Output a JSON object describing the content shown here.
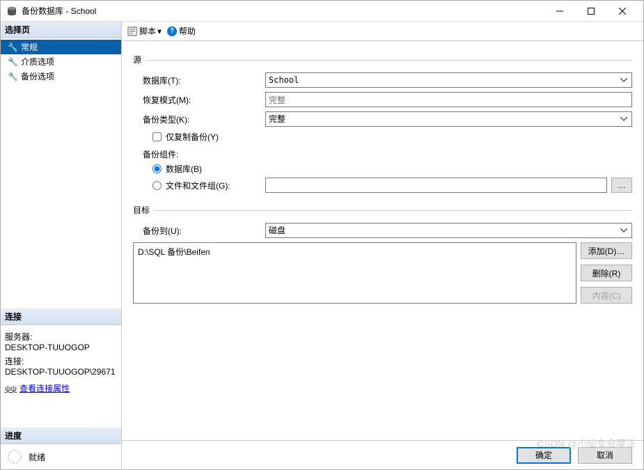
{
  "window": {
    "title": "备份数据库 - School"
  },
  "left": {
    "select_page_header": "选择页",
    "nav": [
      {
        "label": "常规",
        "selected": true
      },
      {
        "label": "介质选项",
        "selected": false
      },
      {
        "label": "备份选项",
        "selected": false
      }
    ],
    "connection_header": "连接",
    "server_label": "服务器:",
    "server_value": "DESKTOP-TUUOGOP",
    "conn_label": "连接:",
    "conn_value": "DESKTOP-TUUOGOP\\29671",
    "view_props": "查看连接属性",
    "progress_header": "进度",
    "progress_status": "就绪"
  },
  "toolbar": {
    "script": "脚本",
    "help": "帮助"
  },
  "source": {
    "group": "源",
    "database_label": "数据库(T):",
    "database_value": "School",
    "recovery_label": "恢复模式(M):",
    "recovery_value": "完整",
    "backup_type_label": "备份类型(K):",
    "backup_type_value": "完整",
    "copy_only_label": "仅复制备份(Y)",
    "component_label": "备份组件:",
    "radio_db": "数据库(B)",
    "radio_fg": "文件和文件组(G):"
  },
  "dest": {
    "group": "目标",
    "backup_to_label": "备份到(U):",
    "backup_to_value": "磁盘",
    "paths": [
      "D:\\SQL 备份\\Beifen"
    ],
    "add_btn": "添加(D)…",
    "remove_btn": "删除(R)",
    "contents_btn": "内容(C)"
  },
  "footer": {
    "ok": "确定",
    "cancel": "取消"
  },
  "watermark": "CSDN @小仙女会魔法"
}
